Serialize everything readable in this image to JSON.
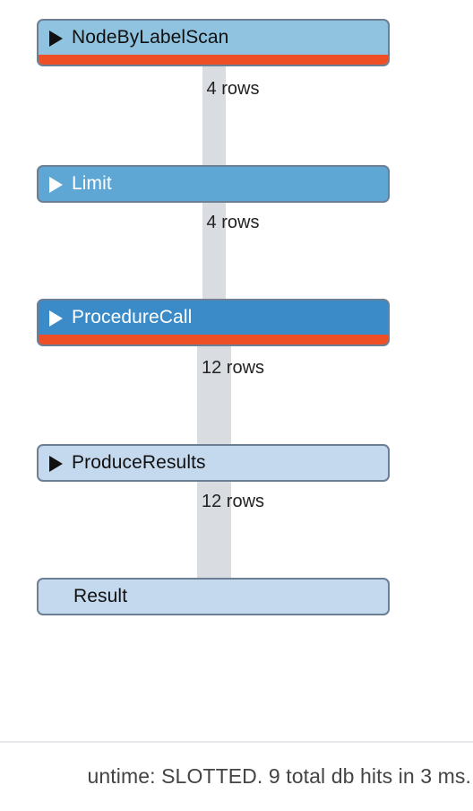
{
  "plan": {
    "operators": [
      {
        "name": "NodeByLabelScan",
        "expandable": true,
        "color": "#8fc3df",
        "text_color": "dark",
        "cost_bar": true
      },
      {
        "name": "Limit",
        "expandable": true,
        "color": "#5ea7d5",
        "text_color": "light",
        "cost_bar": false
      },
      {
        "name": "ProcedureCall",
        "expandable": true,
        "color": "#3b8bc8",
        "text_color": "light",
        "cost_bar": true
      },
      {
        "name": "ProduceResults",
        "expandable": true,
        "color": "#c4d8ee",
        "text_color": "dark",
        "cost_bar": false
      },
      {
        "name": "Result",
        "expandable": false,
        "color": "#c4d8ee",
        "text_color": "dark",
        "cost_bar": false
      }
    ],
    "row_counts": [
      "4 rows",
      "4 rows",
      "12 rows",
      "12 rows"
    ],
    "cost_bar_color": "#ef4f25",
    "pipe_color": "#d9dde2"
  },
  "footer": {
    "summary": "untime: SLOTTED. 9 total db hits in 3 ms."
  }
}
